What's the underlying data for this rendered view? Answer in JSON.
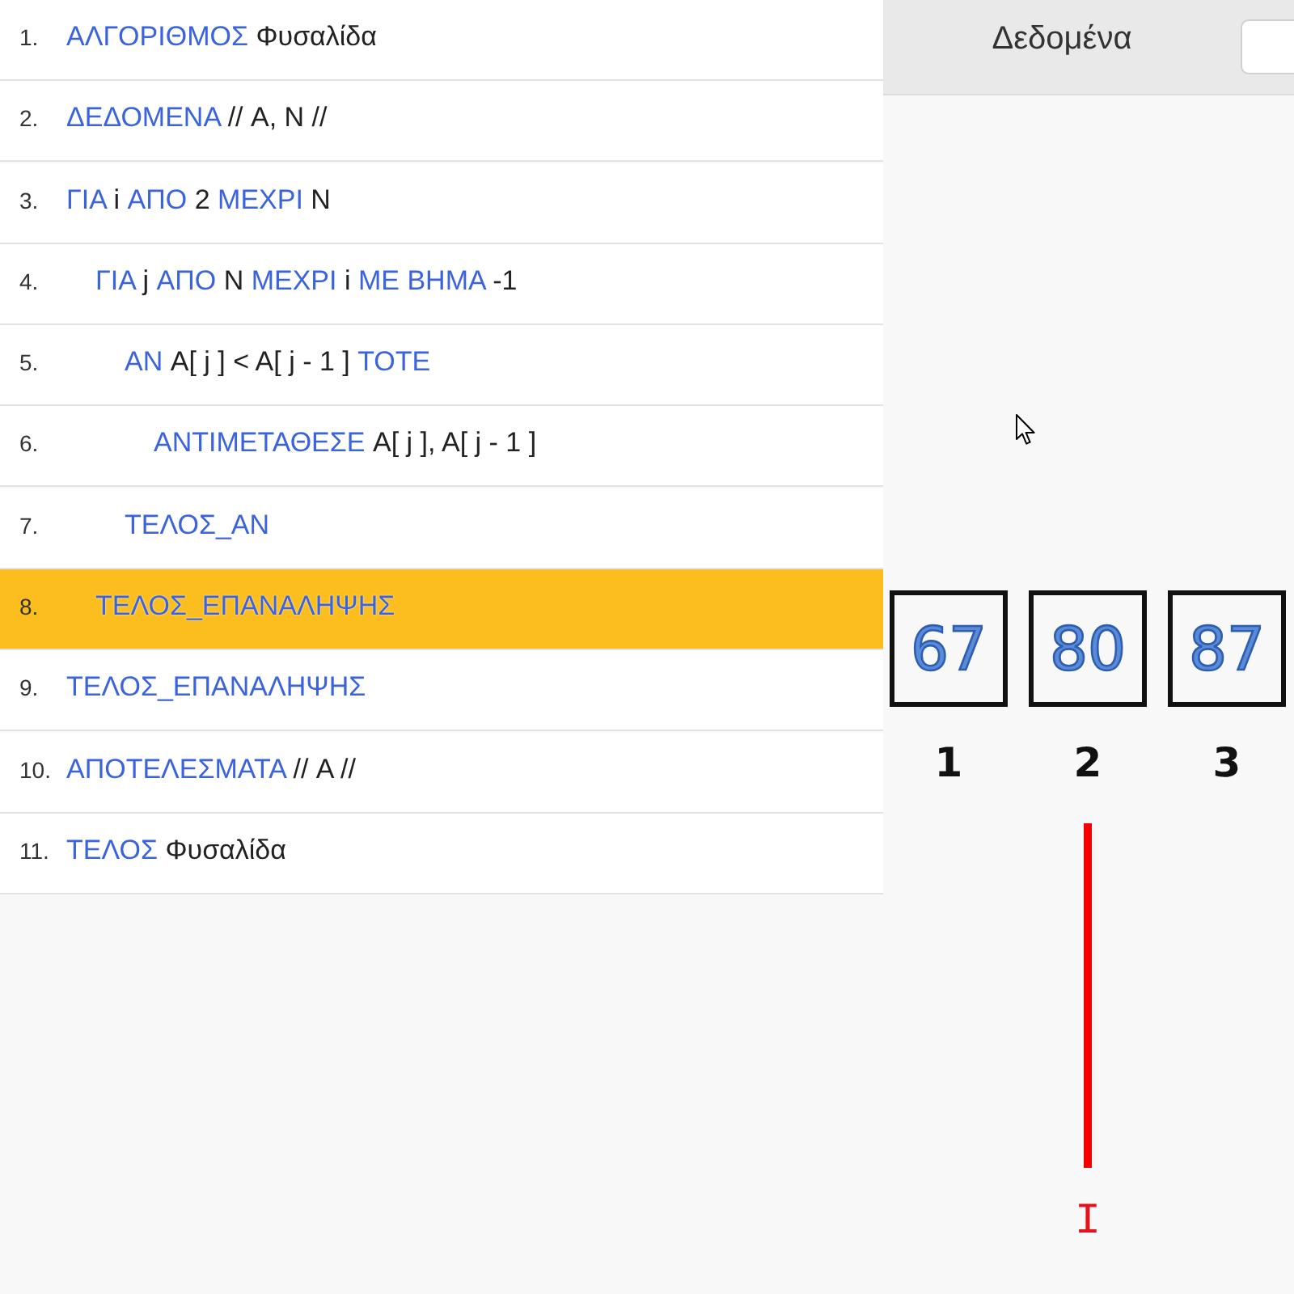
{
  "code": {
    "lines": [
      {
        "number": "1.",
        "selected": false,
        "tokens": [
          {
            "kind": "keyword",
            "text": "ΑΛΓΟΡΙΘΜΟΣ"
          },
          {
            "kind": "text",
            "text": "Φυσαλίδα"
          }
        ]
      },
      {
        "number": "2.",
        "selected": false,
        "tokens": [
          {
            "kind": "keyword",
            "text": "ΔΕΔΟΜΕΝΑ"
          },
          {
            "kind": "text",
            "text": "// A, N //"
          }
        ]
      },
      {
        "number": "3.",
        "selected": false,
        "tokens": [
          {
            "kind": "keyword",
            "text": "ΓΙΑ"
          },
          {
            "kind": "text",
            "text": "i"
          },
          {
            "kind": "keyword",
            "text": "ΑΠΟ"
          },
          {
            "kind": "text",
            "text": "2"
          },
          {
            "kind": "keyword",
            "text": "ΜΕΧΡΙ"
          },
          {
            "kind": "text",
            "text": "N"
          }
        ],
        "children": [
          {
            "number": "4.",
            "selected": false,
            "tokens": [
              {
                "kind": "keyword",
                "text": "ΓΙΑ"
              },
              {
                "kind": "text",
                "text": "j"
              },
              {
                "kind": "keyword",
                "text": "ΑΠΟ"
              },
              {
                "kind": "text",
                "text": "N"
              },
              {
                "kind": "keyword",
                "text": "ΜΕΧΡΙ"
              },
              {
                "kind": "text",
                "text": "i"
              },
              {
                "kind": "keyword",
                "text": "ΜΕ ΒΗΜΑ"
              },
              {
                "kind": "text",
                "text": "-1"
              }
            ],
            "children": [
              {
                "number": "5.",
                "selected": false,
                "tokens": [
                  {
                    "kind": "keyword",
                    "text": "ΑΝ"
                  },
                  {
                    "kind": "text",
                    "text": "A[ j ] < A[ j - 1 ]"
                  },
                  {
                    "kind": "keyword",
                    "text": "ΤΟΤΕ"
                  }
                ],
                "children": [
                  {
                    "number": "6.",
                    "selected": false,
                    "tokens": [
                      {
                        "kind": "keyword",
                        "text": "ΑΝΤΙΜΕΤΑΘΕΣΕ"
                      },
                      {
                        "kind": "text",
                        "text": "A[ j ], A[ j - 1 ]"
                      }
                    ]
                  }
                ]
              },
              {
                "number": "7.",
                "selected": false,
                "tokens": [
                  {
                    "kind": "keyword",
                    "text": "ΤΕΛΟΣ_ΑΝ"
                  }
                ]
              }
            ]
          },
          {
            "number": "8.",
            "selected": true,
            "tokens": [
              {
                "kind": "keyword",
                "text": "ΤΕΛΟΣ_ΕΠΑΝΑΛΗΨΗΣ"
              }
            ]
          }
        ]
      },
      {
        "number": "9.",
        "selected": false,
        "tokens": [
          {
            "kind": "keyword",
            "text": "ΤΕΛΟΣ_ΕΠΑΝΑΛΗΨΗΣ"
          }
        ]
      },
      {
        "number": "10.",
        "selected": false,
        "tokens": [
          {
            "kind": "keyword",
            "text": "ΑΠΟΤΕΛΕΣΜΑΤΑ"
          },
          {
            "kind": "text",
            "text": "// A //"
          }
        ]
      },
      {
        "number": "11.",
        "selected": false,
        "tokens": [
          {
            "kind": "keyword",
            "text": "ΤΕΛΟΣ"
          },
          {
            "kind": "text",
            "text": "Φυσαλίδα"
          }
        ]
      }
    ]
  },
  "data_panel": {
    "title": "Δεδομένα",
    "array": {
      "cells": [
        {
          "value": "67",
          "index": "1"
        },
        {
          "value": "80",
          "index": "2",
          "pointer": {
            "label": "I"
          }
        },
        {
          "value": "87",
          "index": "3"
        }
      ]
    }
  }
}
